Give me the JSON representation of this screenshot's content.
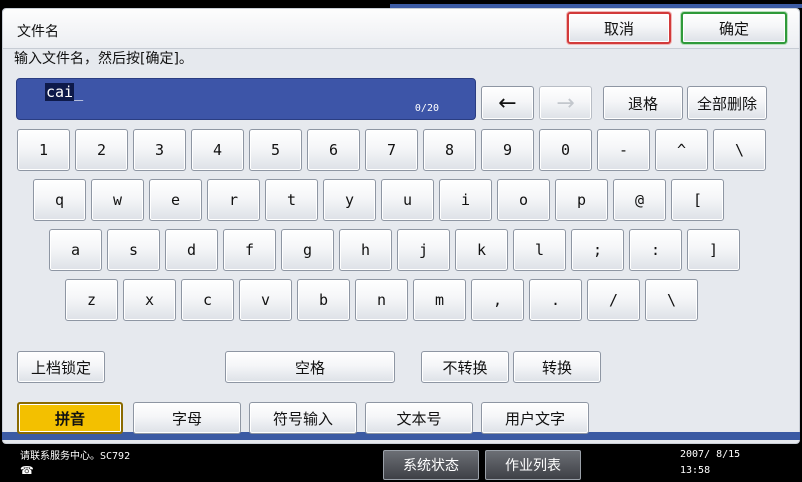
{
  "header": {
    "title": "文件名",
    "cancel_label": "取消",
    "ok_label": "确定"
  },
  "instruction": "输入文件名，然后按[确定]。",
  "input": {
    "value_selected": "cai",
    "value_cursor": "_",
    "counter": "0/20"
  },
  "edit": {
    "left_arrow": "←",
    "right_arrow": "→",
    "backspace": "退格",
    "delete_all": "全部删除"
  },
  "keys": {
    "row1": [
      "1",
      "2",
      "3",
      "4",
      "5",
      "6",
      "7",
      "8",
      "9",
      "0",
      "-",
      "^",
      "\\"
    ],
    "row2": [
      "q",
      "w",
      "e",
      "r",
      "t",
      "y",
      "u",
      "i",
      "o",
      "p",
      "@",
      "["
    ],
    "row3": [
      "a",
      "s",
      "d",
      "f",
      "g",
      "h",
      "j",
      "k",
      "l",
      ";",
      ":",
      "]"
    ],
    "row4": [
      "z",
      "x",
      "c",
      "v",
      "b",
      "n",
      "m",
      ",",
      ".",
      "/",
      "\\"
    ]
  },
  "controls": {
    "shift_lock": "上档锁定",
    "space": "空格",
    "no_convert": "不转换",
    "convert": "转换"
  },
  "tabs": [
    "拼音",
    "字母",
    "符号输入",
    "文本号",
    "用户文字"
  ],
  "status": {
    "message": "请联系服务中心。SC792",
    "icon": "☎",
    "date": "2007/ 8/15",
    "time": "13:58"
  },
  "status_buttons": {
    "system_status": "系统状态",
    "job_list": "作业列表"
  },
  "colors": {
    "input_bg": "#3d55a8",
    "active_tab": "#f3c000",
    "cancel_border": "#d23a3a",
    "ok_border": "#2f9a3a"
  }
}
